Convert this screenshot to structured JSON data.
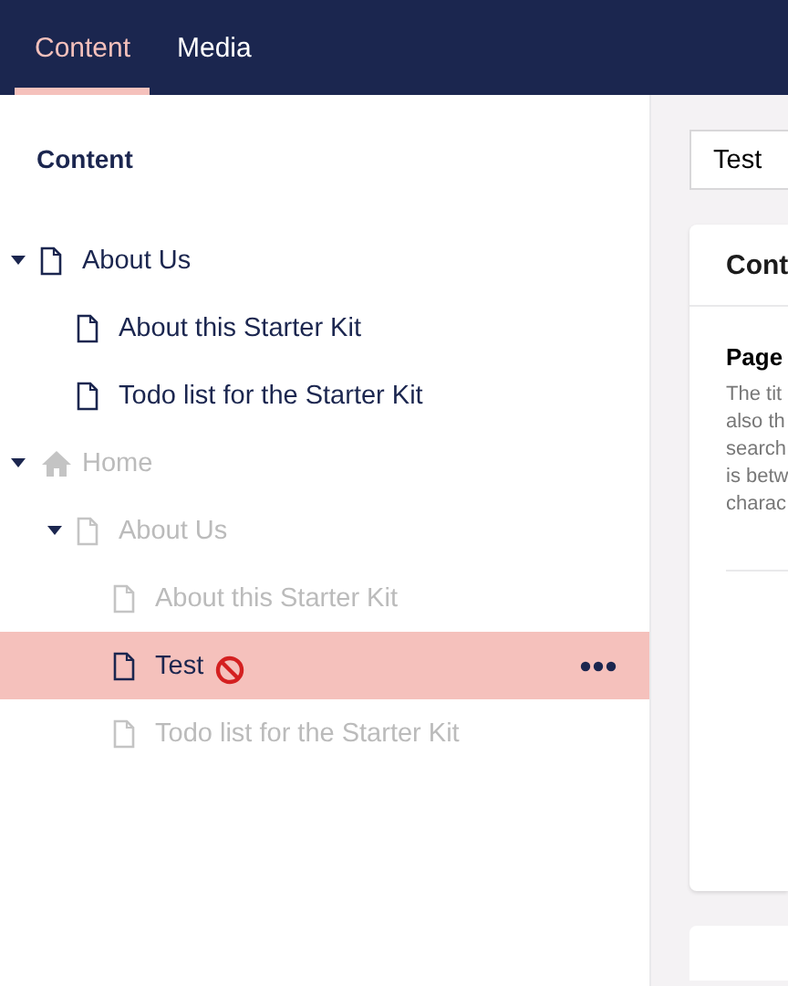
{
  "top_bar": {
    "tabs": [
      {
        "label": "Content",
        "selected": true
      },
      {
        "label": "Media",
        "selected": false
      }
    ]
  },
  "tree": {
    "title": "Content",
    "items": [
      {
        "kind": "page",
        "label": "About Us",
        "expanded": true,
        "disabled": false,
        "selected": false,
        "blocked": false,
        "children": [
          {
            "kind": "page",
            "label": "About this Starter Kit",
            "disabled": false,
            "selected": false,
            "blocked": false
          },
          {
            "kind": "page",
            "label": "Todo list for the Starter Kit",
            "disabled": false,
            "selected": false,
            "blocked": false
          }
        ]
      },
      {
        "kind": "home",
        "label": "Home",
        "expanded": true,
        "disabled": true,
        "selected": false,
        "blocked": false,
        "children": [
          {
            "kind": "page",
            "label": "About Us",
            "expanded": true,
            "disabled": true,
            "selected": false,
            "blocked": false,
            "children": [
              {
                "kind": "page",
                "label": "About this Starter Kit",
                "disabled": true,
                "selected": false,
                "blocked": false
              },
              {
                "kind": "page",
                "label": "Test",
                "disabled": false,
                "selected": true,
                "blocked": true
              },
              {
                "kind": "page",
                "label": "Todo list for the Starter Kit",
                "disabled": true,
                "selected": false,
                "blocked": false
              }
            ]
          }
        ]
      }
    ]
  },
  "editor": {
    "name_field": {
      "value": "Test"
    },
    "card": {
      "header": "Cont",
      "property_label": "Page",
      "description_lines": [
        "The tit",
        "also th",
        "search",
        "is betw",
        "charac"
      ]
    }
  }
}
